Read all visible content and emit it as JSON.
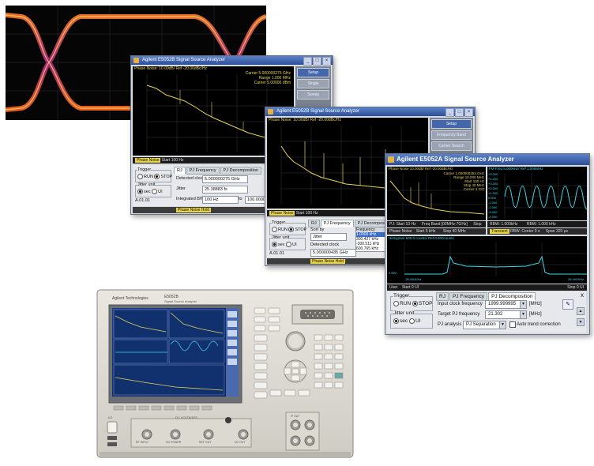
{
  "win1": {
    "title": "Agilent E5052B Signal Source Analyzer",
    "plot_header": "Phase Noise: 10.00dB/ Ref -20.00dBc/Hz",
    "marker_text": [
      "Carrier 5.000000275 GHz",
      "Range 1.000 MHz",
      "Carrier 5.00000 dBm"
    ],
    "side_buttons": [
      "Setup",
      "Single",
      "Sweep"
    ],
    "status_left": "Phase Noise",
    "status_mid": "Start 100 Hz",
    "tabs": [
      "RJ",
      "PJ Frequency",
      "PJ Decomposition"
    ],
    "trigger_label": "Trigger",
    "run": "RUN",
    "stop": "STOP",
    "jitter_label": "Jitter unit",
    "sec": "sec",
    "ui": "UI",
    "detected_clock_label": "Detected clock",
    "detected_clock_value": "5.000000275 GHz",
    "jitter_field_label": "Jitter",
    "jitter_value": "25.38883 fs",
    "integrated_label": "Integrated BW",
    "integrated_value": "100 Hz",
    "to_label": "to",
    "to_value": "100.00000 MHz",
    "version": "A.01.01",
    "bottom_status": "Phase Noise Hold"
  },
  "win2": {
    "title": "Agilent E5052B Signal Source Analyzer",
    "plot_header": "Phase Noise: 10.00dB/ Ref -20.00dBc/Hz",
    "side_buttons": [
      "Setup",
      "Frequency Band",
      "Carrier Search"
    ],
    "status_left": "Phase Noise",
    "status_mid": "Start 100 Hz",
    "tabs": [
      "RJ",
      "PJ Frequency",
      "PJ Decomposition"
    ],
    "trigger_label": "Trigger",
    "run": "RUN",
    "stop": "STOP",
    "jitter_label": "Jitter unit",
    "sec": "sec",
    "ui": "UI",
    "sort_label": "Sort by",
    "sort_value": "Jitter",
    "detected_clock_label": "Detected clock",
    "detected_clock_value": "5.000000435 GHz",
    "freq_header": "Frequency",
    "freq_rows": [
      "1.0000 kHz",
      "300.427 kHz",
      "-300.511 kHz",
      "600.765 kHz"
    ],
    "version": "A.01.01",
    "bottom_status": "Phase Noise Hold"
  },
  "win3": {
    "title": "Agilent E5052A Signal Source Analyzer",
    "pn_header": "Phase Noise 10.00dB/ Ref -20.00dBc/Hz",
    "pn_markers": [
      "Carrier 1.000000353 GHz",
      "Range 10.000 MHz",
      "Start 100 Hz",
      "Stop 40 MHz",
      "Carrier 3.220"
    ],
    "pn_status_left": "PJ: Start 10 Hz",
    "pn_status_mid": "Freq Band [00MHz-7GHz]",
    "pn_status_right": "Stop",
    "pm_status_left": "Phase Noise",
    "pm_status_mid": "Start 5 kHz",
    "pm_status_right": "Stop 40 MHz",
    "fm_header": "FM Freq 5.000kHz/ Ref 1.000MHz",
    "fm_ticks": [
      "+5.000",
      "+4.000",
      "+3.000",
      "+2.000",
      "+1.000",
      "0.000",
      "-1.000",
      "-2.000",
      "-3.000",
      "-4.000"
    ],
    "fm_status_left": "RBW: 1.000kHz",
    "fm_status_right": "RBW: 1.000 kHz",
    "tr_status_left": "Transient",
    "tr_status_mid": "RBW: Center 0 s",
    "tr_status_right": "Span 320 μs",
    "hist_header": "Histogram 500.0 counts/ Ref 0.000counts",
    "hist_x_left": "-26.40UI/Hz",
    "hist_x_right": "26.40UI/Hz",
    "hist_y": "0.000",
    "user_status_left": "User",
    "user_status_mid": "Start 0 UI",
    "user_status_right": "Stop 0 UI",
    "tabs": [
      "RJ",
      "PJ Frequency",
      "PJ Decomposition"
    ],
    "trigger_label": "Trigger",
    "run": "RUN",
    "stop": "STOP",
    "jitter_label": "Jitter unit",
    "sec": "sec",
    "ui": "UI",
    "input_clock_label": "Input clock frequency",
    "input_clock_value": "1999.999995",
    "input_clock_unit": "[MHz]",
    "target_label": "Target PJ frequency",
    "target_value": "21.302",
    "target_unit": "[MHz]",
    "pj_analysis_label": "PJ analysis",
    "pj_analysis_value": "PJ Separation",
    "auto_trend": "Auto trend correction",
    "close_glyph": "x"
  },
  "instrument": {
    "brand": "Agilent Technologies",
    "model": "E5052B",
    "model_sub": "Signal Source Analyzer",
    "front_ports": [
      "RF INPUT",
      "DC POWER",
      "REF OUT",
      "DC OUT",
      "IF OUT"
    ],
    "port_title": "DC VOLTAGES",
    "power_label": "I/O"
  },
  "colors": {
    "eye_bg": "#050505",
    "eye_trace": "#ff5a2a",
    "trace_yellow": "#e6d35a",
    "trace_cyan": "#3fd7e6",
    "title_blue": "#2c4f98"
  }
}
